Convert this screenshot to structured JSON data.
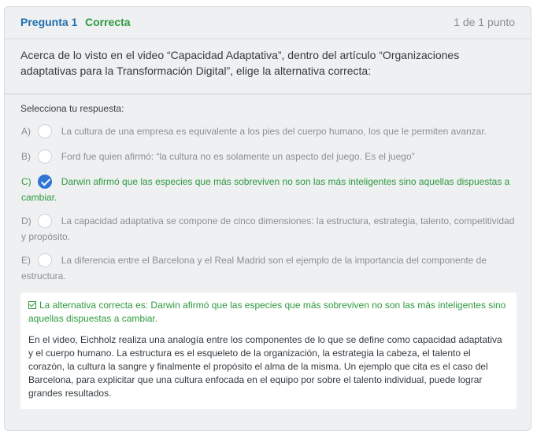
{
  "question": {
    "number_label": "Pregunta 1",
    "status_label": "Correcta",
    "points_label": "1 de 1 punto",
    "prompt": "Acerca de lo visto en el video “Capacidad Adaptativa”, dentro del artículo “Organizaciones adaptativas para la Transformación Digital”, elige la alternativa correcta:"
  },
  "answers": {
    "select_label": "Selecciona tu respuesta:",
    "options": [
      {
        "letter": "A)",
        "text": "La cultura de una empresa es equivalente a los pies del cuerpo humano, los que le permiten avanzar."
      },
      {
        "letter": "B)",
        "text": "Ford fue quien afirmó: “la cultura no es solamente un aspecto del juego. Es el juego”"
      },
      {
        "letter": "C)",
        "text": "Darwin afirmó que las especies que más sobreviven no son las más inteligentes sino aquellas dispuestas a cambiar."
      },
      {
        "letter": "D)",
        "text": "La capacidad adaptativa se compone de cinco dimensiones: la estructura, estrategia, talento, competitividad y propósito."
      },
      {
        "letter": "E)",
        "text": "La diferencia entre el Barcelona y el Real Madrid son el ejemplo de la importancia del componente de estructura."
      }
    ]
  },
  "feedback": {
    "title": "La alternativa correcta es: Darwin afirmó que las especies que más sobreviven no son las más inteligentes sino aquellas dispuestas a cambiar.",
    "body": "En el video, Eichholz realiza una analogía entre los componentes de lo que se define como capacidad adaptativa y el cuerpo humano. La estructura es el esqueleto de la organización, la estrategia la cabeza, el talento el corazón, la cultura la sangre y finalmente el propósito el alma de la misma. Un ejemplo que cita es el caso del Barcelona, para explicitar que una cultura enfocada en el equipo por sobre el talento individual, puede lograr grandes resultados."
  },
  "colors": {
    "accent_blue": "#1f6fae",
    "correct_green": "#2e9a3e",
    "selected_radio": "#2f76d6"
  }
}
